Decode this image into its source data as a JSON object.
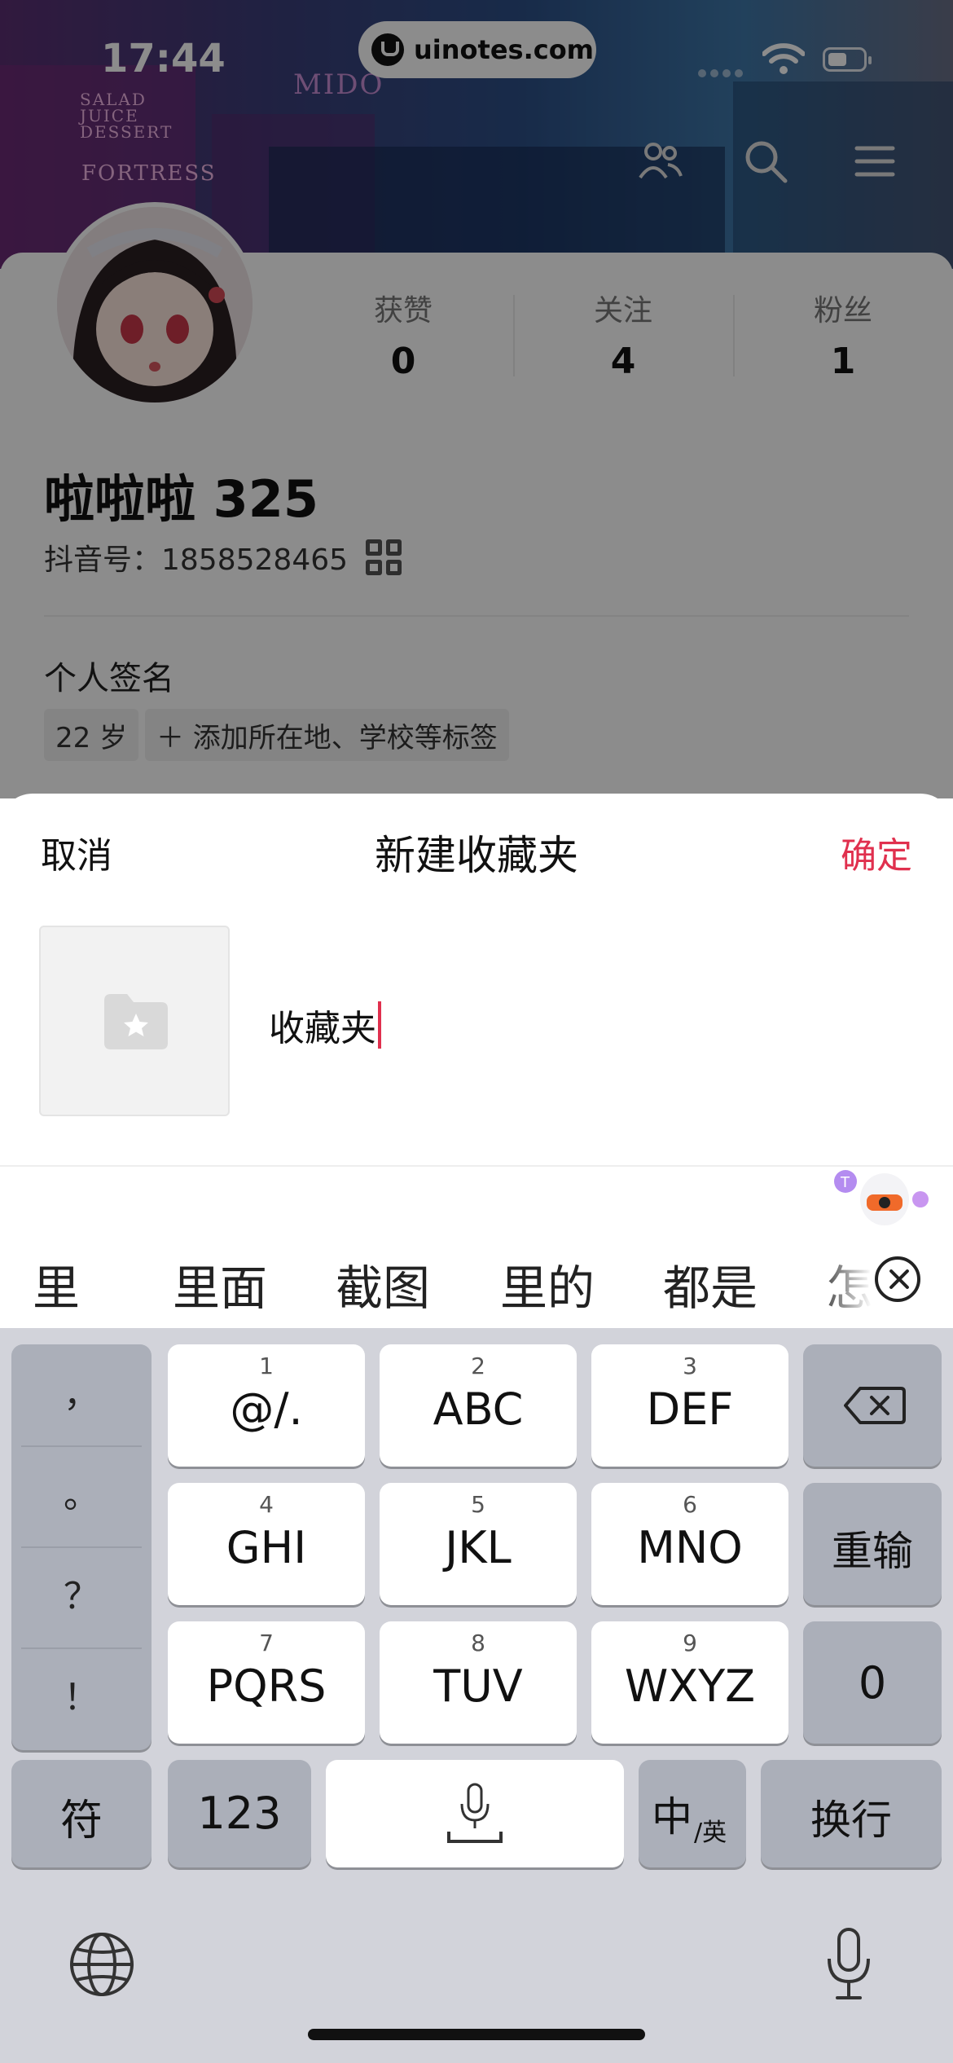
{
  "status_bar": {
    "time": "17:44",
    "url": "uinotes.com"
  },
  "banner": {
    "signs": [
      "SALAD",
      "JUICE",
      "DESSERT",
      "FORTRESS",
      "MIDO"
    ]
  },
  "profile": {
    "stats": [
      {
        "label": "获赞",
        "value": "0"
      },
      {
        "label": "关注",
        "value": "4"
      },
      {
        "label": "粉丝",
        "value": "1"
      }
    ],
    "username": "啦啦啦 325",
    "douyin_id": "抖音号：1858528465",
    "signature": "个人签名",
    "tags": [
      "22 岁",
      "＋ 添加所在地、学校等标签"
    ]
  },
  "sheet": {
    "cancel": "取消",
    "title": "新建收藏夹",
    "confirm": "确定",
    "folder_name_value": "收藏夹"
  },
  "candidates": [
    "里",
    "里面",
    "截图",
    "里的",
    "都是",
    "怎"
  ],
  "keyboard": {
    "punctuation": [
      "，",
      "。",
      "？",
      "！"
    ],
    "keys": [
      {
        "num": "1",
        "label": "@/."
      },
      {
        "num": "2",
        "label": "ABC"
      },
      {
        "num": "3",
        "label": "DEF"
      },
      {
        "num": "4",
        "label": "GHI"
      },
      {
        "num": "5",
        "label": "JKL"
      },
      {
        "num": "6",
        "label": "MNO"
      },
      {
        "num": "7",
        "label": "PQRS"
      },
      {
        "num": "8",
        "label": "TUV"
      },
      {
        "num": "9",
        "label": "WXYZ"
      }
    ],
    "retype": "重输",
    "zero": "0",
    "symbols": "符",
    "numbers": "123",
    "lang_main": "中",
    "lang_sub": "/英",
    "newline": "换行"
  },
  "colors": {
    "accent": "#e0304e",
    "keyboard_bg": "#d2d3da",
    "key_dark": "#abafb9"
  }
}
